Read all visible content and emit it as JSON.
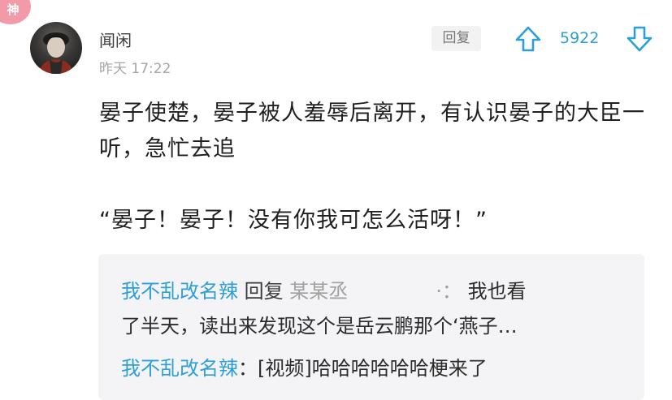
{
  "badge": {
    "label": "神"
  },
  "comment": {
    "author": "闻闲",
    "time": "昨天 17:22",
    "reply_label": "回复",
    "vote_count": "5922",
    "paragraphs": [
      "晏子使楚，晏子被人羞辱后离开，有认识晏子的大臣一听，急忙去追",
      "“晏子！晏子！没有你我可怎么活呀！”"
    ]
  },
  "replies": [
    {
      "user": "我不乱改名辣",
      "verb": "回复",
      "target": "某某丞",
      "sep": "·：",
      "text_head": "我也看",
      "text_tail": "了半天，读出来发现这个是岳云鹏那个‘燕子…"
    },
    {
      "user": "我不乱改名辣",
      "sep": "：",
      "text": "[视频]哈哈哈哈哈哈梗来了"
    }
  ],
  "icons": {
    "upvote": "arrow-up-icon",
    "downvote": "arrow-down-icon",
    "avatar": "user-avatar"
  },
  "colors": {
    "accent": "#2d9fd8",
    "badge": "#f39aa8",
    "reply_box": "#f4f4f6",
    "muted_text": "#a6a6a6"
  }
}
